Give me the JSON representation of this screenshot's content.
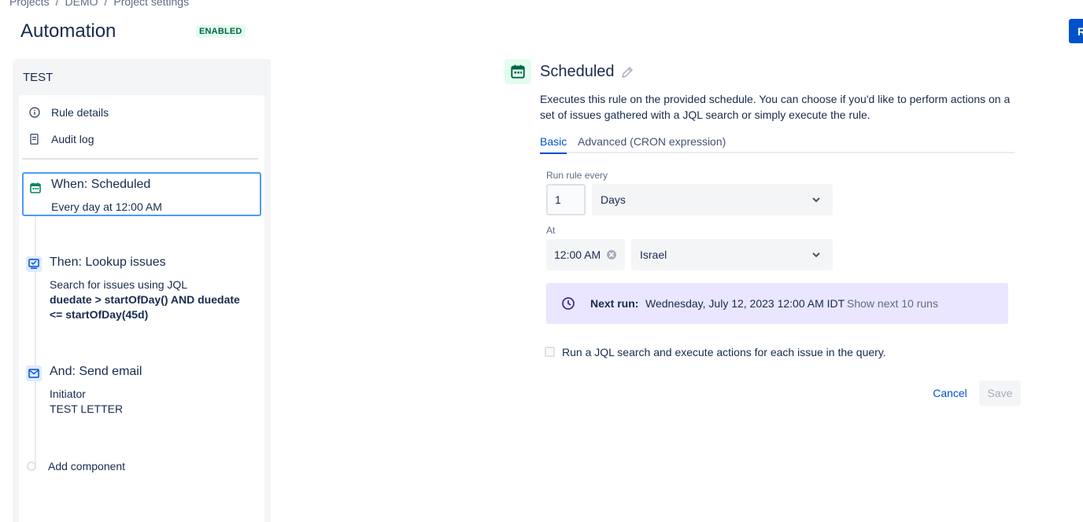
{
  "breadcrumb": {
    "items": [
      "Projects",
      "DEMO",
      "Project settings"
    ]
  },
  "header": {
    "title": "Automation",
    "status": "ENABLED",
    "right_button_label": "R"
  },
  "sidebar": {
    "rule_name": "TEST",
    "nav": [
      {
        "label": "Rule details",
        "icon": "info-icon"
      },
      {
        "label": "Audit log",
        "icon": "document-icon"
      }
    ],
    "components": [
      {
        "title": "When: Scheduled",
        "subtitle": "Every day at 12:00 AM",
        "icon": "calendar-icon",
        "color": "#00875a"
      },
      {
        "title": "Then: Lookup issues",
        "subtitle": "Search for issues using JQL",
        "detail": "duedate > startOfDay() AND duedate <= startOfDay(45d)",
        "icon": "lookup-icon",
        "color": "#0052cc"
      },
      {
        "title": "And: Send email",
        "line1": "Initiator",
        "line2": "TEST LETTER",
        "icon": "email-icon",
        "color": "#0052cc"
      }
    ],
    "add_component_label": "Add component"
  },
  "config": {
    "title": "Scheduled",
    "description": "Executes this rule on the provided schedule. You can choose if you'd like to perform actions on a set of issues gathered with a JQL search or simply execute the rule.",
    "tabs": {
      "basic": "Basic",
      "advanced": "Advanced (CRON expression)"
    },
    "run_rule_every_label": "Run rule every",
    "interval_value": "1",
    "interval_unit": "Days",
    "at_label": "At",
    "time_value": "12:00 AM",
    "timezone": "Israel",
    "next_run": {
      "label": "Next run:",
      "value": "Wednesday, July 12, 2023 12:00 AM IDT",
      "link": "Show next 10 runs"
    },
    "jql_checkbox_label": "Run a JQL search and execute actions for each issue in the query.",
    "jql_checkbox_checked": false,
    "cancel_label": "Cancel",
    "save_label": "Save"
  },
  "colors": {
    "accent": "#0052cc",
    "success": "#00875a",
    "next_run_bg": "#eae6ff"
  }
}
